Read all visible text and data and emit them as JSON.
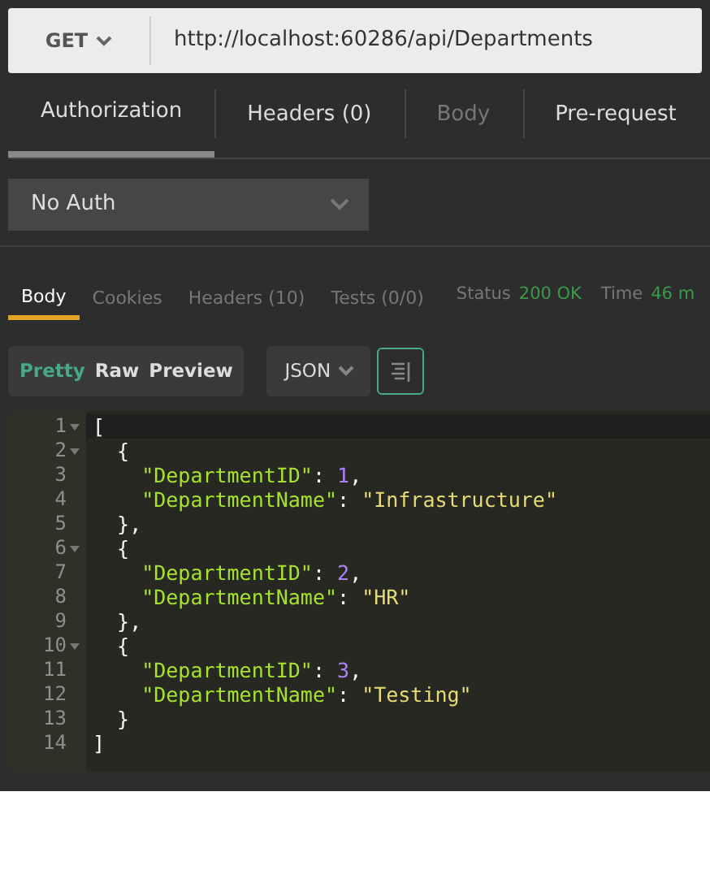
{
  "request": {
    "method": "GET",
    "url": "http://localhost:60286/api/Departments"
  },
  "request_tabs": [
    {
      "label": "Authorization",
      "selected": true,
      "disabled": false
    },
    {
      "label": "Headers (0)",
      "selected": false,
      "disabled": false
    },
    {
      "label": "Body",
      "selected": false,
      "disabled": true
    },
    {
      "label": "Pre-request",
      "selected": false,
      "disabled": false
    }
  ],
  "auth_type": "No Auth",
  "response_tabs": [
    {
      "label": "Body",
      "selected": true
    },
    {
      "label": "Cookies",
      "selected": false
    },
    {
      "label": "Headers (10)",
      "selected": false
    },
    {
      "label": "Tests (0/0)",
      "selected": false
    }
  ],
  "status": {
    "status_label": "Status",
    "status_value": "200 OK",
    "time_label": "Time",
    "time_value": "46 m"
  },
  "view_modes": [
    {
      "label": "Pretty",
      "selected": true
    },
    {
      "label": "Raw",
      "selected": false
    },
    {
      "label": "Preview",
      "selected": false
    }
  ],
  "format": "JSON",
  "code_lines": [
    {
      "number": "1",
      "foldable": true,
      "tokens": [
        {
          "kind": "punct",
          "text": "["
        }
      ]
    },
    {
      "number": "2",
      "foldable": true,
      "tokens": [
        {
          "kind": "punct",
          "text": "  {"
        }
      ]
    },
    {
      "number": "3",
      "foldable": false,
      "tokens": [
        {
          "kind": "key",
          "text": "    \"DepartmentID\""
        },
        {
          "kind": "punct",
          "text": ": "
        },
        {
          "kind": "number",
          "text": "1"
        },
        {
          "kind": "punct",
          "text": ","
        }
      ]
    },
    {
      "number": "4",
      "foldable": false,
      "tokens": [
        {
          "kind": "key",
          "text": "    \"DepartmentName\""
        },
        {
          "kind": "punct",
          "text": ": "
        },
        {
          "kind": "string",
          "text": "\"Infrastructure\""
        }
      ]
    },
    {
      "number": "5",
      "foldable": false,
      "tokens": [
        {
          "kind": "punct",
          "text": "  },"
        }
      ]
    },
    {
      "number": "6",
      "foldable": true,
      "tokens": [
        {
          "kind": "punct",
          "text": "  {"
        }
      ]
    },
    {
      "number": "7",
      "foldable": false,
      "tokens": [
        {
          "kind": "key",
          "text": "    \"DepartmentID\""
        },
        {
          "kind": "punct",
          "text": ": "
        },
        {
          "kind": "number",
          "text": "2"
        },
        {
          "kind": "punct",
          "text": ","
        }
      ]
    },
    {
      "number": "8",
      "foldable": false,
      "tokens": [
        {
          "kind": "key",
          "text": "    \"DepartmentName\""
        },
        {
          "kind": "punct",
          "text": ": "
        },
        {
          "kind": "string",
          "text": "\"HR\""
        }
      ]
    },
    {
      "number": "9",
      "foldable": false,
      "tokens": [
        {
          "kind": "punct",
          "text": "  },"
        }
      ]
    },
    {
      "number": "10",
      "foldable": true,
      "tokens": [
        {
          "kind": "punct",
          "text": "  {"
        }
      ]
    },
    {
      "number": "11",
      "foldable": false,
      "tokens": [
        {
          "kind": "key",
          "text": "    \"DepartmentID\""
        },
        {
          "kind": "punct",
          "text": ": "
        },
        {
          "kind": "number",
          "text": "3"
        },
        {
          "kind": "punct",
          "text": ","
        }
      ]
    },
    {
      "number": "12",
      "foldable": false,
      "tokens": [
        {
          "kind": "key",
          "text": "    \"DepartmentName\""
        },
        {
          "kind": "punct",
          "text": ": "
        },
        {
          "kind": "string",
          "text": "\"Testing\""
        }
      ]
    },
    {
      "number": "13",
      "foldable": false,
      "tokens": [
        {
          "kind": "punct",
          "text": "  }"
        }
      ]
    },
    {
      "number": "14",
      "foldable": false,
      "tokens": [
        {
          "kind": "punct",
          "text": "]"
        }
      ]
    }
  ]
}
